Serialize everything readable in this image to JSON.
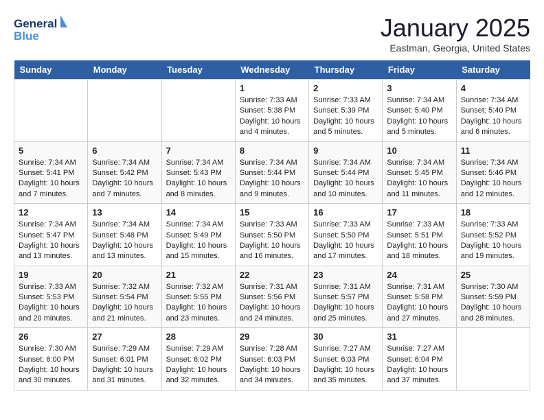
{
  "header": {
    "logo_line1": "General",
    "logo_line2": "Blue",
    "month": "January 2025",
    "location": "Eastman, Georgia, United States"
  },
  "days_of_week": [
    "Sunday",
    "Monday",
    "Tuesday",
    "Wednesday",
    "Thursday",
    "Friday",
    "Saturday"
  ],
  "weeks": [
    [
      {
        "day": "",
        "empty": true
      },
      {
        "day": "",
        "empty": true
      },
      {
        "day": "",
        "empty": true
      },
      {
        "day": "1",
        "sunrise": "7:33 AM",
        "sunset": "5:38 PM",
        "daylight": "10 hours and 4 minutes."
      },
      {
        "day": "2",
        "sunrise": "7:33 AM",
        "sunset": "5:39 PM",
        "daylight": "10 hours and 5 minutes."
      },
      {
        "day": "3",
        "sunrise": "7:34 AM",
        "sunset": "5:40 PM",
        "daylight": "10 hours and 5 minutes."
      },
      {
        "day": "4",
        "sunrise": "7:34 AM",
        "sunset": "5:40 PM",
        "daylight": "10 hours and 6 minutes."
      }
    ],
    [
      {
        "day": "5",
        "sunrise": "7:34 AM",
        "sunset": "5:41 PM",
        "daylight": "10 hours and 7 minutes."
      },
      {
        "day": "6",
        "sunrise": "7:34 AM",
        "sunset": "5:42 PM",
        "daylight": "10 hours and 7 minutes."
      },
      {
        "day": "7",
        "sunrise": "7:34 AM",
        "sunset": "5:43 PM",
        "daylight": "10 hours and 8 minutes."
      },
      {
        "day": "8",
        "sunrise": "7:34 AM",
        "sunset": "5:44 PM",
        "daylight": "10 hours and 9 minutes."
      },
      {
        "day": "9",
        "sunrise": "7:34 AM",
        "sunset": "5:44 PM",
        "daylight": "10 hours and 10 minutes."
      },
      {
        "day": "10",
        "sunrise": "7:34 AM",
        "sunset": "5:45 PM",
        "daylight": "10 hours and 11 minutes."
      },
      {
        "day": "11",
        "sunrise": "7:34 AM",
        "sunset": "5:46 PM",
        "daylight": "10 hours and 12 minutes."
      }
    ],
    [
      {
        "day": "12",
        "sunrise": "7:34 AM",
        "sunset": "5:47 PM",
        "daylight": "10 hours and 13 minutes."
      },
      {
        "day": "13",
        "sunrise": "7:34 AM",
        "sunset": "5:48 PM",
        "daylight": "10 hours and 13 minutes."
      },
      {
        "day": "14",
        "sunrise": "7:34 AM",
        "sunset": "5:49 PM",
        "daylight": "10 hours and 15 minutes."
      },
      {
        "day": "15",
        "sunrise": "7:33 AM",
        "sunset": "5:50 PM",
        "daylight": "10 hours and 16 minutes."
      },
      {
        "day": "16",
        "sunrise": "7:33 AM",
        "sunset": "5:50 PM",
        "daylight": "10 hours and 17 minutes."
      },
      {
        "day": "17",
        "sunrise": "7:33 AM",
        "sunset": "5:51 PM",
        "daylight": "10 hours and 18 minutes."
      },
      {
        "day": "18",
        "sunrise": "7:33 AM",
        "sunset": "5:52 PM",
        "daylight": "10 hours and 19 minutes."
      }
    ],
    [
      {
        "day": "19",
        "sunrise": "7:33 AM",
        "sunset": "5:53 PM",
        "daylight": "10 hours and 20 minutes."
      },
      {
        "day": "20",
        "sunrise": "7:32 AM",
        "sunset": "5:54 PM",
        "daylight": "10 hours and 21 minutes."
      },
      {
        "day": "21",
        "sunrise": "7:32 AM",
        "sunset": "5:55 PM",
        "daylight": "10 hours and 23 minutes."
      },
      {
        "day": "22",
        "sunrise": "7:31 AM",
        "sunset": "5:56 PM",
        "daylight": "10 hours and 24 minutes."
      },
      {
        "day": "23",
        "sunrise": "7:31 AM",
        "sunset": "5:57 PM",
        "daylight": "10 hours and 25 minutes."
      },
      {
        "day": "24",
        "sunrise": "7:31 AM",
        "sunset": "5:58 PM",
        "daylight": "10 hours and 27 minutes."
      },
      {
        "day": "25",
        "sunrise": "7:30 AM",
        "sunset": "5:59 PM",
        "daylight": "10 hours and 28 minutes."
      }
    ],
    [
      {
        "day": "26",
        "sunrise": "7:30 AM",
        "sunset": "6:00 PM",
        "daylight": "10 hours and 30 minutes."
      },
      {
        "day": "27",
        "sunrise": "7:29 AM",
        "sunset": "6:01 PM",
        "daylight": "10 hours and 31 minutes."
      },
      {
        "day": "28",
        "sunrise": "7:29 AM",
        "sunset": "6:02 PM",
        "daylight": "10 hours and 32 minutes."
      },
      {
        "day": "29",
        "sunrise": "7:28 AM",
        "sunset": "6:03 PM",
        "daylight": "10 hours and 34 minutes."
      },
      {
        "day": "30",
        "sunrise": "7:27 AM",
        "sunset": "6:03 PM",
        "daylight": "10 hours and 35 minutes."
      },
      {
        "day": "31",
        "sunrise": "7:27 AM",
        "sunset": "6:04 PM",
        "daylight": "10 hours and 37 minutes."
      },
      {
        "day": "",
        "empty": true
      }
    ]
  ],
  "labels": {
    "sunrise": "Sunrise:",
    "sunset": "Sunset:",
    "daylight": "Daylight:"
  }
}
